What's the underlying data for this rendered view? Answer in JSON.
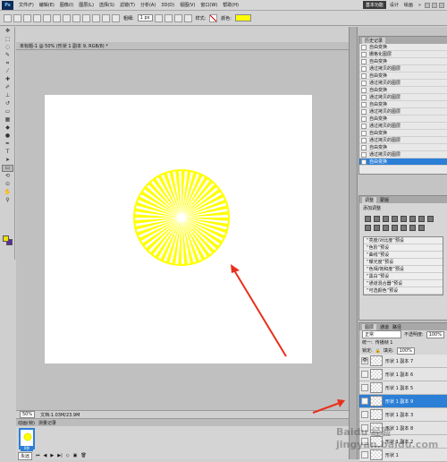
{
  "app": {
    "logo": "Ps",
    "zoom": "50%"
  },
  "menu": [
    "文件(F)",
    "编辑(E)",
    "图像(I)",
    "图层(L)",
    "选择(S)",
    "滤镜(T)",
    "分析(A)",
    "3D(D)",
    "视图(V)",
    "窗口(W)",
    "帮助(H)"
  ],
  "workspace": {
    "active": "基本功能",
    "others": [
      "设计",
      "绘画"
    ],
    "more": "»"
  },
  "options": {
    "weight_label": "粗细:",
    "weight_value": "1 px",
    "style_label": "样式:",
    "color_label": "颜色:",
    "color": "#ffff00"
  },
  "document": {
    "tab": "未标题-1 @ 50% (形状 1 副本 9, RGB/8) *",
    "zoom": "50%",
    "info": "文档:1.03M/23.9M"
  },
  "tools": [
    "move-icon",
    "marquee-icon",
    "lasso-icon",
    "quick-select-icon",
    "crop-icon",
    "eyedropper-icon",
    "healing-icon",
    "brush-icon",
    "stamp-icon",
    "history-brush-icon",
    "eraser-icon",
    "gradient-icon",
    "blur-icon",
    "dodge-icon",
    "pen-icon",
    "type-icon",
    "path-select-icon",
    "shape-icon",
    "3d-rotate-icon",
    "3d-orbit-icon",
    "hand-icon",
    "zoom-icon"
  ],
  "history": {
    "tab": "历史记录",
    "items": [
      "自由变换",
      "栅格化图层",
      "自由变换",
      "通过拷贝的图层",
      "自由变换",
      "通过拷贝的图层",
      "自由变换",
      "通过拷贝的图层",
      "自由变换",
      "通过拷贝的图层",
      "自由变换",
      "通过拷贝的图层",
      "自由变换",
      "通过拷贝的图层",
      "自由变换",
      "通过拷贝的图层",
      "自由变换"
    ],
    "selected_index": 16
  },
  "adjustments": {
    "tabs": [
      "调整",
      "蒙版"
    ],
    "title": "添加调整",
    "presets": [
      "“亮度/对比度”预设",
      "“色阶”预设",
      "“曲线”预设",
      "“曝光度”预设",
      "“色相/饱和度”预设",
      "“黑白”预设",
      "“通道混合器”预设",
      "“可选颜色”预设"
    ]
  },
  "layers": {
    "tabs": [
      "图层",
      "通道",
      "路径"
    ],
    "blend": "正常",
    "opacity_label": "不透明度:",
    "opacity": "100%",
    "lock_label": "锁定:",
    "fill_label": "填充:",
    "fill": "100%",
    "propagate": "统一:",
    "propagate_check": "传播帧 1",
    "items": [
      {
        "name": "形状 1 副本 7",
        "visible": true
      },
      {
        "name": "形状 1 副本 6",
        "visible": false
      },
      {
        "name": "形状 1 副本 5",
        "visible": false
      },
      {
        "name": "形状 1 副本 9",
        "visible": true,
        "selected": true
      },
      {
        "name": "形状 1 副本 3",
        "visible": false
      },
      {
        "name": "形状 1 副本 8",
        "visible": false
      },
      {
        "name": "形状 1 副本 2",
        "visible": false
      },
      {
        "name": "形状 1",
        "visible": false
      }
    ]
  },
  "timeline": {
    "tabs": [
      "动画(帧)",
      "测量记录"
    ],
    "frame_index": "1",
    "frame_time": "0秒",
    "loop": "永远"
  },
  "watermark": "Baidu 经验 jingyan.baidu.com",
  "colors": {
    "starburst": "#ffff00",
    "selected": "#2b7fd6",
    "arrow": "#e8301c"
  }
}
